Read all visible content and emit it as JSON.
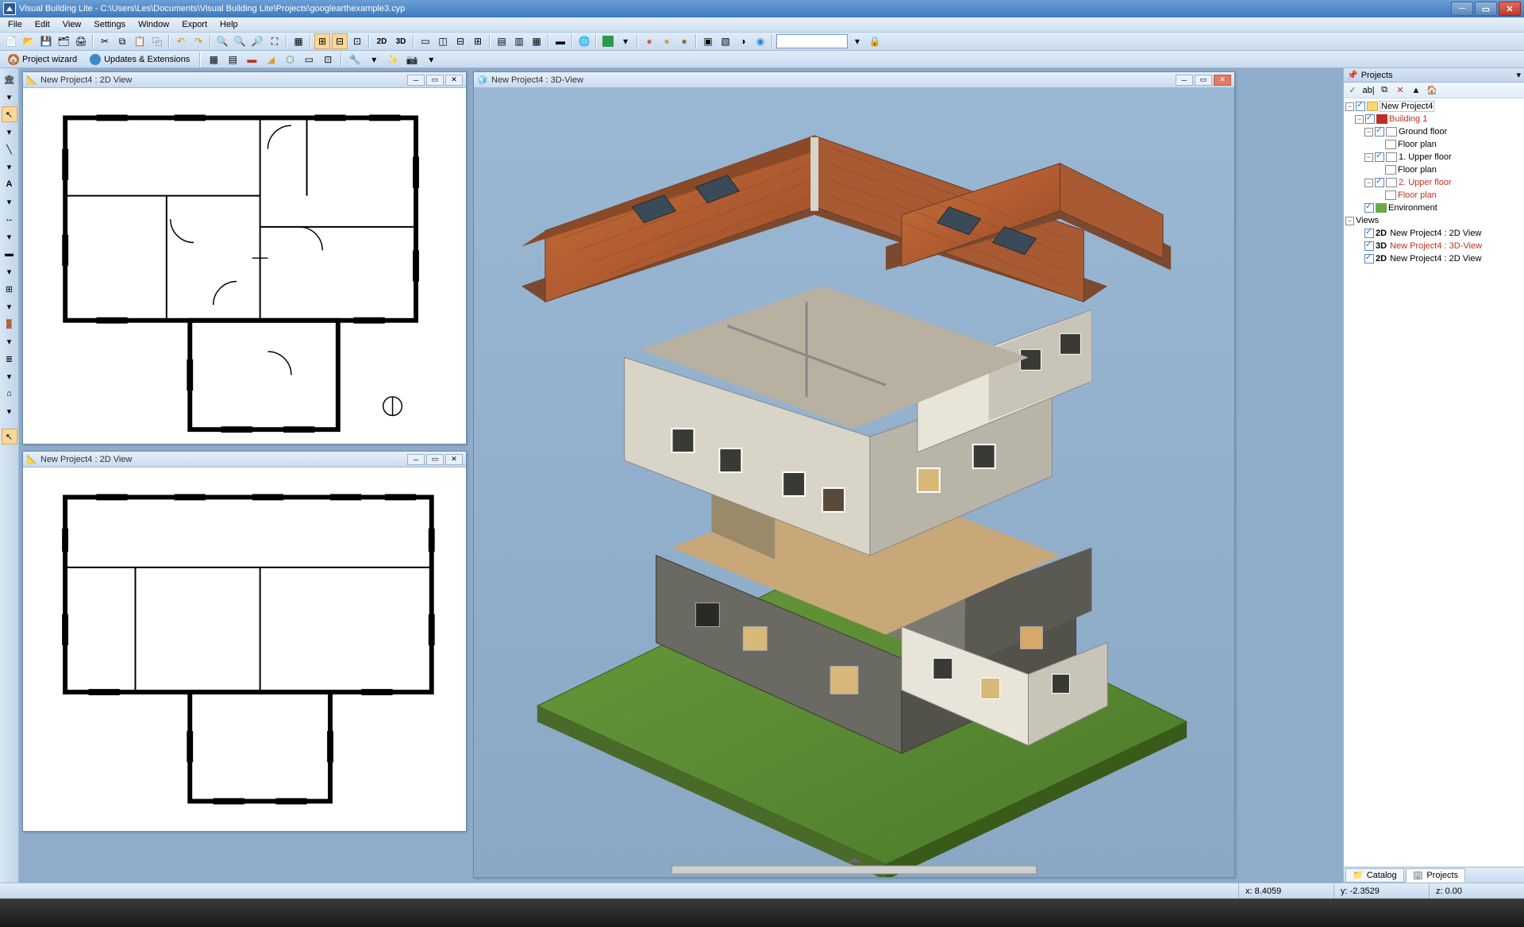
{
  "window": {
    "title": "Visual Building Lite - C:\\Users\\Les\\Documents\\Visual Building Lite\\Projects\\googlearthexample3.cyp"
  },
  "menu": {
    "file": "File",
    "edit": "Edit",
    "view": "View",
    "settings": "Settings",
    "window": "Window",
    "export": "Export",
    "help": "Help"
  },
  "secondbar": {
    "wizard": "Project wizard",
    "updates": "Updates & Extensions"
  },
  "toolbar": {
    "t2d": "2D",
    "t3d": "3D"
  },
  "mdi": {
    "win1": "New Project4 : 2D View",
    "win2": "New Project4 : 2D View",
    "win3": "New Project4 : 3D-View"
  },
  "projects": {
    "title": "Projects",
    "root": "New Project4",
    "building": "Building 1",
    "ground": "Ground floor",
    "floorplan": "Floor plan",
    "upper1": "1. Upper floor",
    "upper2": "2. Upper floor",
    "env": "Environment",
    "views": "Views",
    "v1pre": "2D",
    "v1": "New Project4 : 2D View",
    "v2pre": "3D",
    "v2": "New Project4 : 3D-View",
    "v3pre": "2D",
    "v3": "New Project4 : 2D View"
  },
  "tabs": {
    "catalog": "Catalog",
    "projects": "Projects"
  },
  "status": {
    "x": "x: 8.4059",
    "y": "y: -2.3529",
    "z": "z: 0.00"
  }
}
